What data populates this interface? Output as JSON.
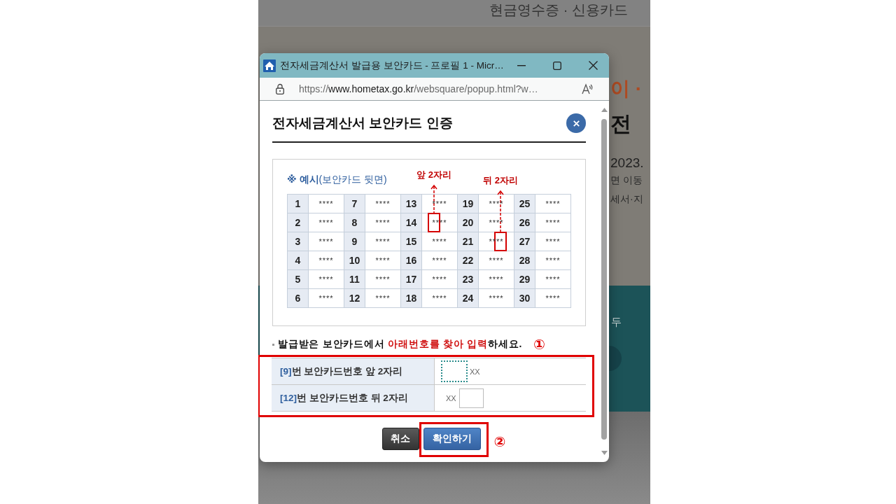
{
  "background_page": {
    "header": "현금영수증 · 신용카드",
    "headline": "이 ·",
    "title": "전",
    "date": "2023.",
    "lines": [
      "면 이동",
      "세서·지"
    ],
    "banner_text": "두"
  },
  "popup_window": {
    "title": "전자세금계산서 발급용 보안카드 - 프로필 1 - Micr…",
    "url": {
      "scheme": "https://",
      "domain": "www.hometax.go.kr",
      "path": "/websquare/popup.html?w…"
    }
  },
  "dialog": {
    "title": "전자세금계산서 보안카드 인증",
    "example": {
      "caption": "**※ 예시**(보안카드 뒷면)",
      "rows": [
        [
          {
            "number": "1",
            "value": "****"
          },
          {
            "number": "7",
            "value": "****"
          },
          {
            "number": "13",
            "value": "****"
          },
          {
            "number": "19",
            "value": "****"
          },
          {
            "number": "25",
            "value": "****"
          }
        ],
        [
          {
            "number": "2",
            "value": "****"
          },
          {
            "number": "8",
            "value": "****"
          },
          {
            "number": "14",
            "value": "****",
            "callout": {
              "label": "앞 2자리",
              "kind": "front"
            }
          },
          {
            "number": "20",
            "value": "****"
          },
          {
            "number": "26",
            "value": "****"
          }
        ],
        [
          {
            "number": "3",
            "value": "****"
          },
          {
            "number": "9",
            "value": "****"
          },
          {
            "number": "15",
            "value": "****"
          },
          {
            "number": "21",
            "value": "****",
            "callout": {
              "label": "뒤 2자리",
              "kind": "back"
            }
          },
          {
            "number": "27",
            "value": "****"
          }
        ],
        [
          {
            "number": "4",
            "value": "****"
          },
          {
            "number": "10",
            "value": "****"
          },
          {
            "number": "16",
            "value": "****"
          },
          {
            "number": "22",
            "value": "****"
          },
          {
            "number": "28",
            "value": "****"
          }
        ],
        [
          {
            "number": "5",
            "value": "****"
          },
          {
            "number": "11",
            "value": "****"
          },
          {
            "number": "17",
            "value": "****"
          },
          {
            "number": "23",
            "value": "****"
          },
          {
            "number": "29",
            "value": "****"
          }
        ],
        [
          {
            "number": "6",
            "value": "****"
          },
          {
            "number": "12",
            "value": "****"
          },
          {
            "number": "18",
            "value": "****"
          },
          {
            "number": "24",
            "value": "****"
          },
          {
            "number": "30",
            "value": "****"
          }
        ]
      ]
    },
    "instruction": {
      "parts": [
        {
          "text": "발급받은 보안카드에서 ",
          "emphasis": false
        },
        {
          "text": "아래번호를 찾아 입력",
          "emphasis": true
        },
        {
          "text": "하세요.",
          "emphasis": false
        }
      ],
      "step_marker": "①"
    },
    "input_table": {
      "highlighted": true,
      "rows": [
        {
          "number": "[9]",
          "label": "번 보안카드번호 앞 2자리",
          "kind": "front",
          "mask": "XX",
          "focused": true
        },
        {
          "number": "[12]",
          "label": "번 보안카드번호 뒤 2자리",
          "kind": "back",
          "mask": "XX",
          "focused": false
        }
      ]
    },
    "buttons": [
      {
        "label": "취소",
        "kind": "cancel",
        "highlighted": false
      },
      {
        "label": "확인하기",
        "kind": "confirm",
        "highlighted": true,
        "step_marker": "②"
      }
    ]
  }
}
